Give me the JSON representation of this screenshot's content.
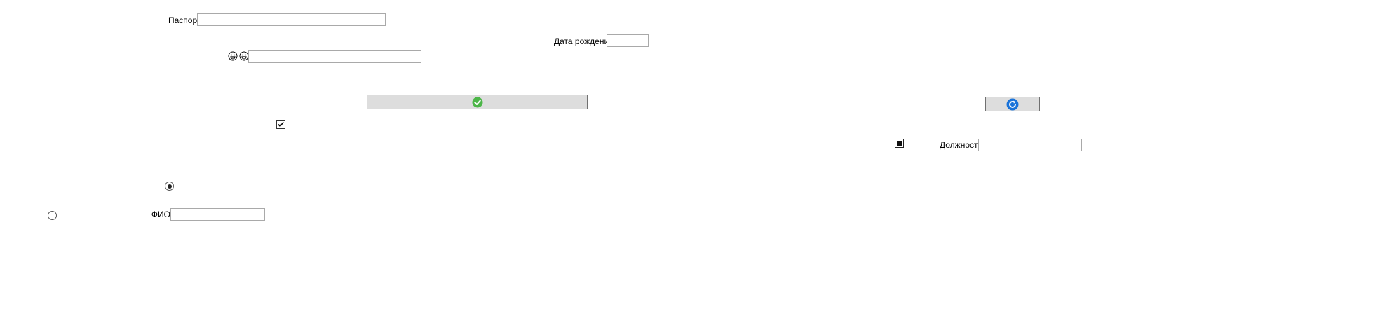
{
  "form": {
    "passport_label": "Паспорт",
    "passport_value": "",
    "birthdate_label": "Дата рождения",
    "birthdate_value": "",
    "emoji_field_value": "",
    "position_label": "Должность",
    "position_value": "",
    "fio_label": "ФИО",
    "fio_value": ""
  },
  "controls": {
    "confirm_button_icon": "check-circle-icon",
    "refresh_button_icon": "refresh-icon",
    "checkbox_checked": true,
    "square_checkbox_state": "indeterminate",
    "radio_1_selected": true,
    "radio_2_selected": false
  },
  "icons": {
    "emoji_1": "grinning-face-icon",
    "emoji_2": "smiling-face-icon"
  },
  "colors": {
    "confirm_icon_green": "#4cb648",
    "refresh_icon_blue": "#1a73d9",
    "button_bg": "#dddddd",
    "field_border": "#a9a9a9"
  }
}
